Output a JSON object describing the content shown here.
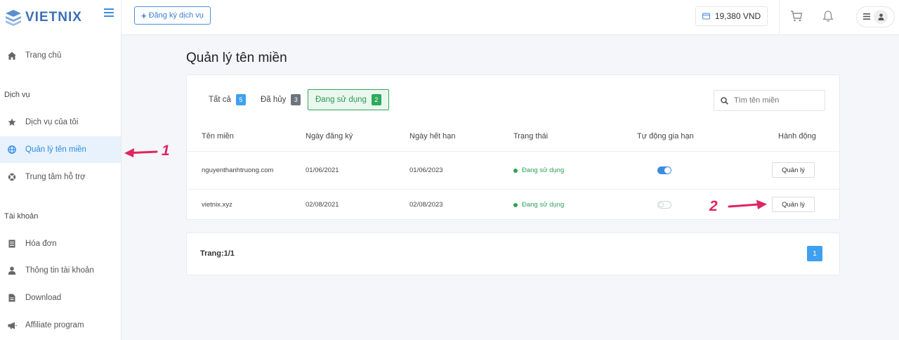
{
  "brand": {
    "name": "VIETNIX"
  },
  "topbar": {
    "register_label": "Đăng ký dịch vụ",
    "balance": "19,380 VND"
  },
  "sidebar": {
    "home": "Trang chủ",
    "services_section": "Dịch vụ",
    "my_services": "Dịch vụ của tôi",
    "domain_mgmt": "Quản lý tên miền",
    "support": "Trung tâm hỗ trợ",
    "account_section": "Tài khoản",
    "invoices": "Hóa đơn",
    "account_info": "Thông tin tài khoản",
    "download": "Download",
    "affiliate": "Affiliate program"
  },
  "main": {
    "title": "Quản lý tên miền",
    "filters": [
      {
        "label": "Tất cả",
        "count": "5",
        "color": "#3ea0ee"
      },
      {
        "label": "Đã hủy",
        "count": "3",
        "color": "#6c757d"
      },
      {
        "label": "Đang sử dụng",
        "count": "2",
        "color": "#2eaa5b"
      }
    ],
    "search_placeholder": "Tìm tên miền",
    "columns": [
      "Tên miền",
      "Ngày đăng ký",
      "Ngày hết hạn",
      "Trạng thái",
      "Tự động gia hạn",
      "Hành động"
    ],
    "rows": [
      {
        "domain": "nguyenthanhtruong.com",
        "registered": "01/06/2021",
        "expires": "01/06/2023",
        "status": "Đang sử dụng",
        "auto_renew": true,
        "action": "Quản lý"
      },
      {
        "domain": "vietnix.xyz",
        "registered": "02/08/2021",
        "expires": "02/08/2023",
        "status": "Đang sử dụng",
        "auto_renew": false,
        "action": "Quản lý"
      }
    ],
    "page_info": "Trang:1/1",
    "current_page": "1"
  },
  "annotations": {
    "one": "1",
    "two": "2"
  },
  "colors": {
    "primary": "#3b8ce0",
    "success": "#2eaa5b",
    "annotation": "#e0245e"
  }
}
